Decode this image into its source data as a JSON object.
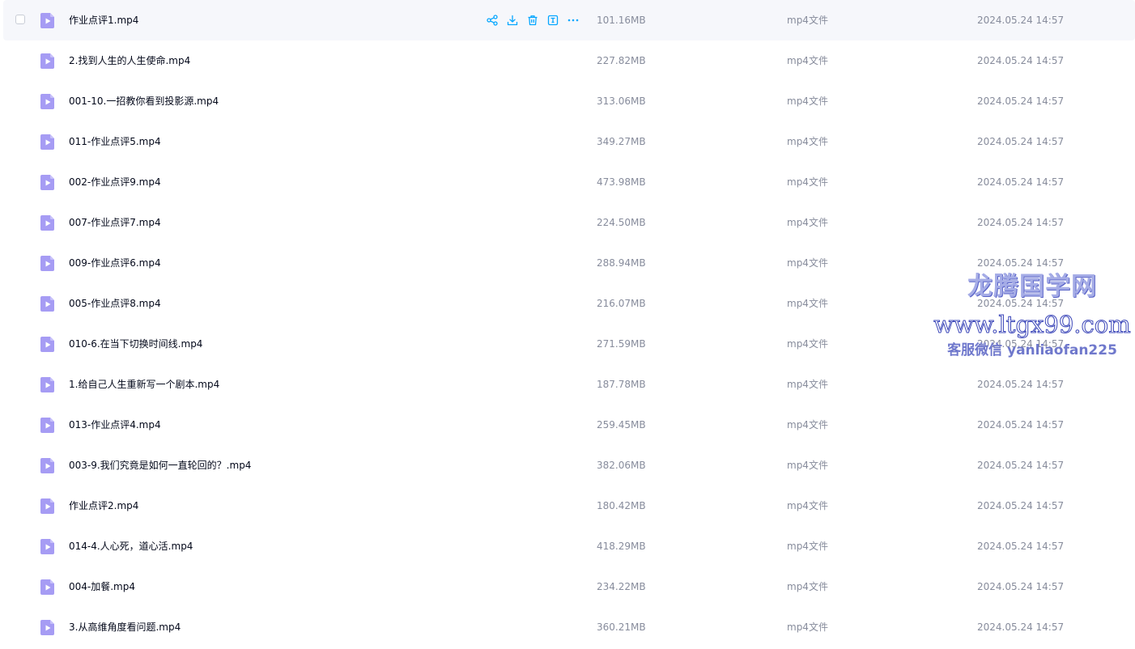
{
  "colors": {
    "accent": "#06a7ff",
    "file_icon": "#a69cf4",
    "hover_row_bg": "#f6f7fb",
    "muted_text": "#878c9c",
    "watermark": "#6f78cc"
  },
  "row_actions": [
    {
      "icon": "share-icon"
    },
    {
      "icon": "download-icon"
    },
    {
      "icon": "delete-icon"
    },
    {
      "icon": "rename-icon"
    },
    {
      "icon": "more-icon"
    }
  ],
  "files": [
    {
      "name": "作业点评1.mp4",
      "size": "101.16MB",
      "type": "mp4文件",
      "date": "2024.05.24 14:57",
      "icon": "video-file-icon"
    },
    {
      "name": "2.找到人生的人生使命.mp4",
      "size": "227.82MB",
      "type": "mp4文件",
      "date": "2024.05.24 14:57",
      "icon": "video-file-icon"
    },
    {
      "name": "001-10.一招教你看到投影源.mp4",
      "size": "313.06MB",
      "type": "mp4文件",
      "date": "2024.05.24 14:57",
      "icon": "video-file-icon"
    },
    {
      "name": "011-作业点评5.mp4",
      "size": "349.27MB",
      "type": "mp4文件",
      "date": "2024.05.24 14:57",
      "icon": "video-file-icon"
    },
    {
      "name": "002-作业点评9.mp4",
      "size": "473.98MB",
      "type": "mp4文件",
      "date": "2024.05.24 14:57",
      "icon": "video-file-icon"
    },
    {
      "name": "007-作业点评7.mp4",
      "size": "224.50MB",
      "type": "mp4文件",
      "date": "2024.05.24 14:57",
      "icon": "video-file-icon"
    },
    {
      "name": "009-作业点评6.mp4",
      "size": "288.94MB",
      "type": "mp4文件",
      "date": "2024.05.24 14:57",
      "icon": "video-file-icon"
    },
    {
      "name": "005-作业点评8.mp4",
      "size": "216.07MB",
      "type": "mp4文件",
      "date": "2024.05.24 14:57",
      "icon": "video-file-icon"
    },
    {
      "name": "010-6.在当下切换时间线.mp4",
      "size": "271.59MB",
      "type": "mp4文件",
      "date": "2024.05.24 14:57",
      "icon": "video-file-icon"
    },
    {
      "name": "1.给自己人生重新写一个剧本.mp4",
      "size": "187.78MB",
      "type": "mp4文件",
      "date": "2024.05.24 14:57",
      "icon": "video-file-icon"
    },
    {
      "name": "013-作业点评4.mp4",
      "size": "259.45MB",
      "type": "mp4文件",
      "date": "2024.05.24 14:57",
      "icon": "video-file-icon"
    },
    {
      "name": "003-9.我们究竟是如何一直轮回的？.mp4",
      "size": "382.06MB",
      "type": "mp4文件",
      "date": "2024.05.24 14:57",
      "icon": "video-file-icon"
    },
    {
      "name": "作业点评2.mp4",
      "size": "180.42MB",
      "type": "mp4文件",
      "date": "2024.05.24 14:57",
      "icon": "video-file-icon"
    },
    {
      "name": "014-4.人心死，道心活.mp4",
      "size": "418.29MB",
      "type": "mp4文件",
      "date": "2024.05.24 14:57",
      "icon": "video-file-icon"
    },
    {
      "name": "004-加餐.mp4",
      "size": "234.22MB",
      "type": "mp4文件",
      "date": "2024.05.24 14:57",
      "icon": "video-file-icon"
    },
    {
      "name": "3.从高维角度看问题.mp4",
      "size": "360.21MB",
      "type": "mp4文件",
      "date": "2024.05.24 14:57",
      "icon": "video-file-icon"
    }
  ],
  "watermark": {
    "line1": "龙腾国学网",
    "line2": "www.ltgx99.com",
    "line3": "客服微信 yanliaofan225"
  }
}
